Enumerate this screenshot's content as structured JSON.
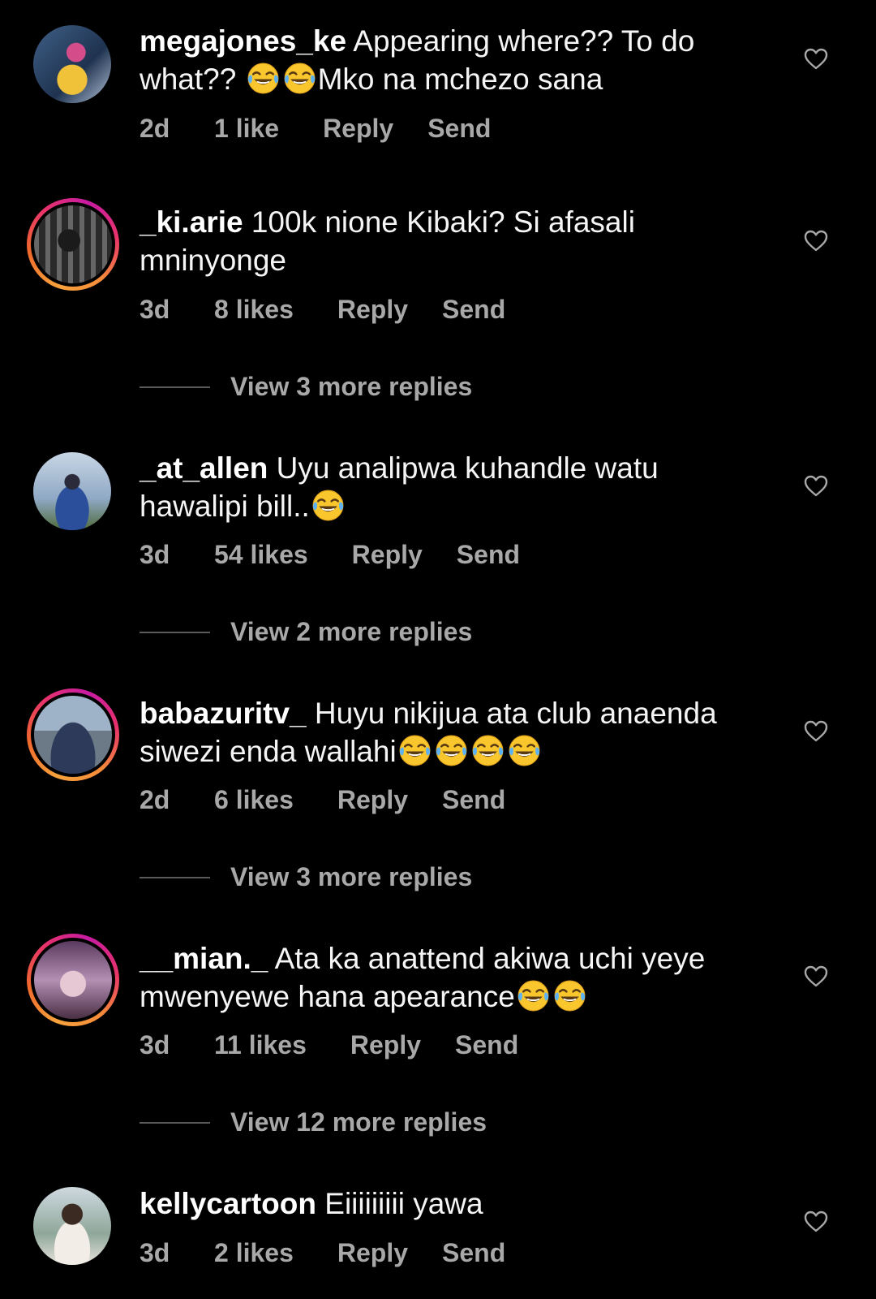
{
  "comments": [
    {
      "username": "megajones_ke",
      "text_before": "Appearing where?? To do what?? ",
      "emojis_mid": 2,
      "text_after": "Mko na mchezo sana",
      "time": "2d",
      "likes": "1 like",
      "reply": "Reply",
      "send": "Send",
      "story_ring": false
    },
    {
      "username": "_ki.arie",
      "text_before": "100k nione Kibaki? Si afasali mninyonge",
      "time": "3d",
      "likes": "8 likes",
      "reply": "Reply",
      "send": "Send",
      "story_ring": true,
      "view_replies": "View 3 more replies"
    },
    {
      "username": "_at_allen",
      "text_before": "Uyu analipwa kuhandle watu hawalipi bill..",
      "emojis_end": 1,
      "time": "3d",
      "likes": "54 likes",
      "reply": "Reply",
      "send": "Send",
      "story_ring": false,
      "view_replies": "View 2 more replies"
    },
    {
      "username": "babazuritv_",
      "text_before": "Huyu nikijua ata club anaenda siwezi enda wallahi",
      "emojis_end": 4,
      "time": "2d",
      "likes": "6 likes",
      "reply": "Reply",
      "send": "Send",
      "story_ring": true,
      "view_replies": "View 3 more replies"
    },
    {
      "username": "__mian._",
      "text_before": "Ata ka anattend akiwa uchi yeye mwenyewe hana apearance",
      "emojis_end": 2,
      "time": "3d",
      "likes": "11 likes",
      "reply": "Reply",
      "send": "Send",
      "story_ring": true,
      "view_replies": "View 12 more replies"
    },
    {
      "username": "kellycartoon",
      "text_before": "Eiiiiiiiii yawa",
      "time": "3d",
      "likes": "2 likes",
      "reply": "Reply",
      "send": "Send",
      "story_ring": false
    }
  ],
  "icons": {
    "like": "heart-outline-icon",
    "emoji": "face-with-tears-of-joy"
  },
  "colors": {
    "background": "#000000",
    "text": "#f5f5f5",
    "secondary": "#a8a8a8",
    "ring_start": "#f7a23c",
    "ring_end": "#c71ba3"
  }
}
